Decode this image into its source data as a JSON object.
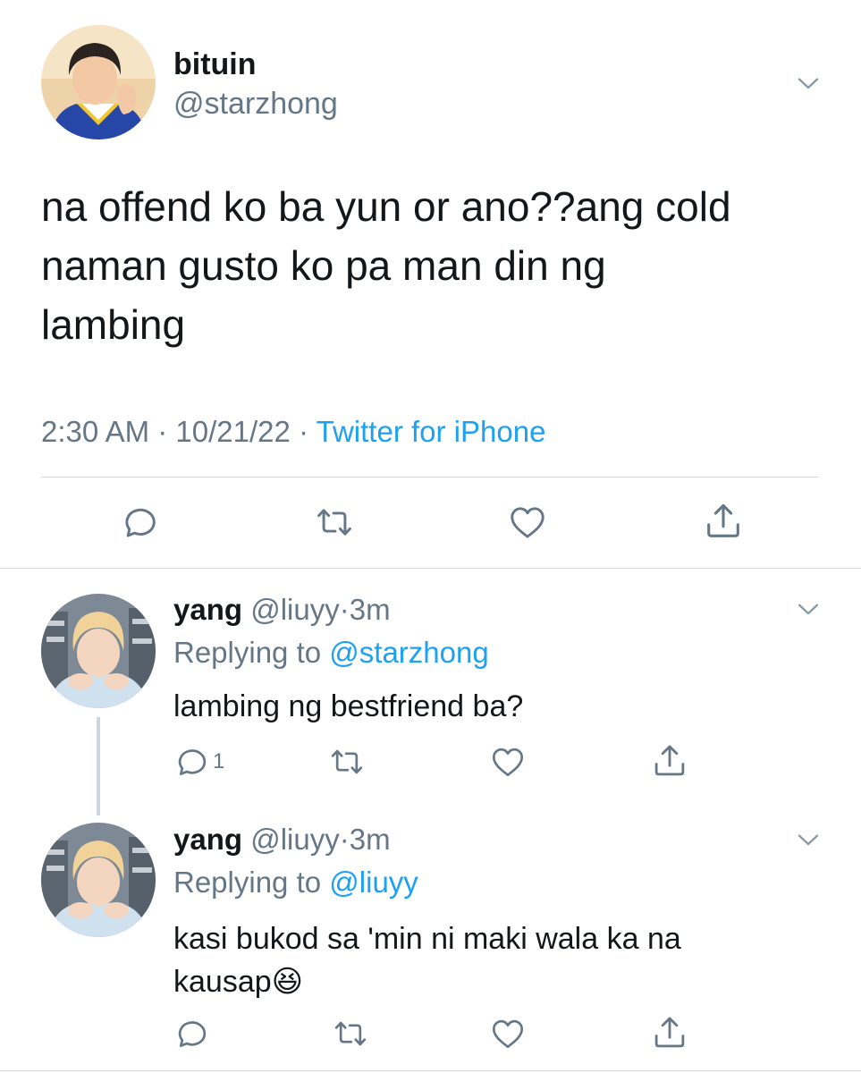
{
  "main_tweet": {
    "display_name": "bituin",
    "handle": "@starzhong",
    "text_lines": [
      "na offend ko ba yun or ano??ang cold",
      "naman gusto ko pa man din ng",
      "lambing"
    ],
    "time": "2:30 AM",
    "sep": "·",
    "date": "10/21/22",
    "source": "Twitter for iPhone"
  },
  "replies": [
    {
      "display_name": "yang",
      "handle": "@liuyy",
      "dot": "·",
      "age": "3m",
      "replying_label": "Replying to",
      "replying_handle": "@starzhong",
      "text": "lambing ng bestfriend ba?",
      "reply_count": "1"
    },
    {
      "display_name": "yang",
      "handle": "@liuyy",
      "dot": "·",
      "age": "3m",
      "replying_label": "Replying to",
      "replying_handle": "@liuyy",
      "text_line1": "kasi bukod sa 'min ni maki wala ka na",
      "text_line2": "kausap",
      "emoji": "😆",
      "reply_count": ""
    }
  ],
  "icons": {
    "reply": "reply-icon",
    "retweet": "retweet-icon",
    "like": "heart-icon",
    "share": "share-icon",
    "more": "chevron-down-icon"
  },
  "colors": {
    "link": "#1da1f2",
    "muted": "#657786",
    "divider": "#dadde0",
    "text": "#14171a"
  }
}
